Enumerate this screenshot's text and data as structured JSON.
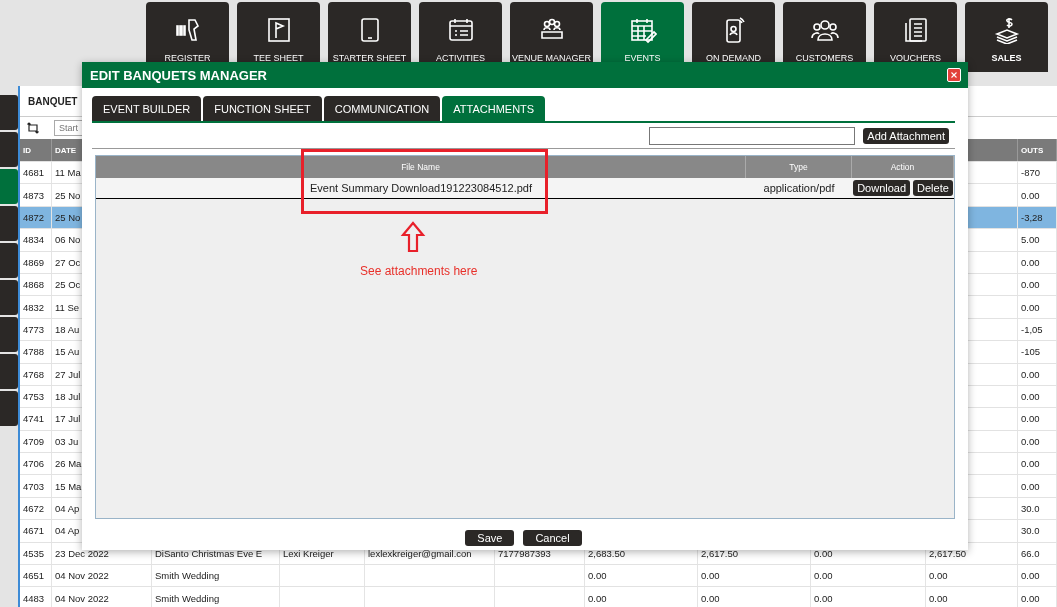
{
  "nav": [
    {
      "label": "REGISTER",
      "selected": false
    },
    {
      "label": "TEE SHEET",
      "selected": false
    },
    {
      "label": "STARTER SHEET",
      "selected": false
    },
    {
      "label": "ACTIVITIES",
      "selected": false
    },
    {
      "label": "VENUE MANAGER",
      "selected": false
    },
    {
      "label": "EVENTS",
      "selected": true
    },
    {
      "label": "ON DEMAND",
      "selected": false
    },
    {
      "label": "CUSTOMERS",
      "selected": false
    },
    {
      "label": "VOUCHERS",
      "selected": false
    },
    {
      "label": "SALES",
      "selected": false
    }
  ],
  "sidebar": {
    "items": [
      {
        "selected": false
      },
      {
        "selected": false
      },
      {
        "selected": true
      },
      {
        "selected": false
      },
      {
        "selected": false
      },
      {
        "selected": false
      },
      {
        "selected": false
      },
      {
        "selected": false
      },
      {
        "selected": false
      }
    ]
  },
  "panel": {
    "tab": "BANQUET",
    "search": {
      "placeholder": "Start"
    },
    "table": {
      "columns": {
        "id": "ID",
        "date": "DATE",
        "outs": "OUTS"
      },
      "rows": [
        {
          "id": "4681",
          "date": "11 Ma",
          "outs": "-870",
          "selected": false
        },
        {
          "id": "4873",
          "date": "25 No",
          "outs": "0.00",
          "selected": false
        },
        {
          "id": "4872",
          "date": "25 No",
          "outs": "-3,28",
          "selected": true
        },
        {
          "id": "4834",
          "date": "06 No",
          "outs": "5.00",
          "selected": false
        },
        {
          "id": "4869",
          "date": "27 Oc",
          "outs": "0.00",
          "selected": false
        },
        {
          "id": "4868",
          "date": "25 Oc",
          "outs": "0.00",
          "selected": false
        },
        {
          "id": "4832",
          "date": "11 Se",
          "outs": "0.00",
          "selected": false
        },
        {
          "id": "4773",
          "date": "18 Au",
          "outs": "-1,05",
          "selected": false
        },
        {
          "id": "4788",
          "date": "15 Au",
          "outs": "-105",
          "selected": false
        },
        {
          "id": "4768",
          "date": "27 Jul",
          "outs": "0.00",
          "selected": false
        },
        {
          "id": "4753",
          "date": "18 Jul",
          "outs": "0.00",
          "selected": false
        },
        {
          "id": "4741",
          "date": "17 Jul",
          "outs": "0.00",
          "selected": false
        },
        {
          "id": "4709",
          "date": "03 Ju",
          "outs": "0.00",
          "selected": false
        },
        {
          "id": "4706",
          "date": "26 Ma",
          "outs": "0.00",
          "selected": false
        },
        {
          "id": "4703",
          "date": "15 Ma",
          "outs": "0.00",
          "selected": false
        },
        {
          "id": "4672",
          "date": "04 Ap",
          "outs": "30.0",
          "selected": false
        },
        {
          "id": "4671",
          "date": "04 Ap",
          "outs": "30.0",
          "selected": false
        },
        {
          "id": "4535",
          "date": "23 Dec 2022",
          "column_3": "DiSanto Christmas Eve E",
          "column_4": "Lexi Kreiger",
          "column_5": "lexlexkreiger@gmail.con",
          "column_6": "7177987393",
          "column_7": "2,683.50",
          "column_8": "2,617.50",
          "column_9": "0.00",
          "column_10": "2,617.50",
          "outs": "66.0",
          "selected": false
        },
        {
          "id": "4651",
          "date": "04 Nov 2022",
          "column_3": "Smith Wedding",
          "column_7": "0.00",
          "column_8": "0.00",
          "column_9": "0.00",
          "column_10": "0.00",
          "outs": "0.00",
          "selected": false
        },
        {
          "id": "4483",
          "date": "04 Nov 2022",
          "column_3": "Smith Wedding",
          "column_7": "0.00",
          "column_8": "0.00",
          "column_9": "0.00",
          "column_10": "0.00",
          "outs": "0.00",
          "selected": false
        }
      ]
    }
  },
  "modal": {
    "title": "EDIT BANQUETS MANAGER",
    "tabs": [
      {
        "label": "EVENT BUILDER",
        "selected": false
      },
      {
        "label": "FUNCTION SHEET",
        "selected": false
      },
      {
        "label": "COMMUNICATION",
        "selected": false
      },
      {
        "label": "ATTACHMENTS",
        "selected": true
      }
    ],
    "add_button": "Add Attachment",
    "attachments": {
      "columns": {
        "file_name": "File Name",
        "type": "Type",
        "action": "Action"
      },
      "rows": [
        {
          "file_name": "Event Summary Download191223084512.pdf",
          "type": "application/pdf",
          "actions": [
            "Download",
            "Delete"
          ]
        }
      ]
    },
    "annotation": "See attachments here",
    "buttons": [
      "Save",
      "Cancel"
    ]
  }
}
